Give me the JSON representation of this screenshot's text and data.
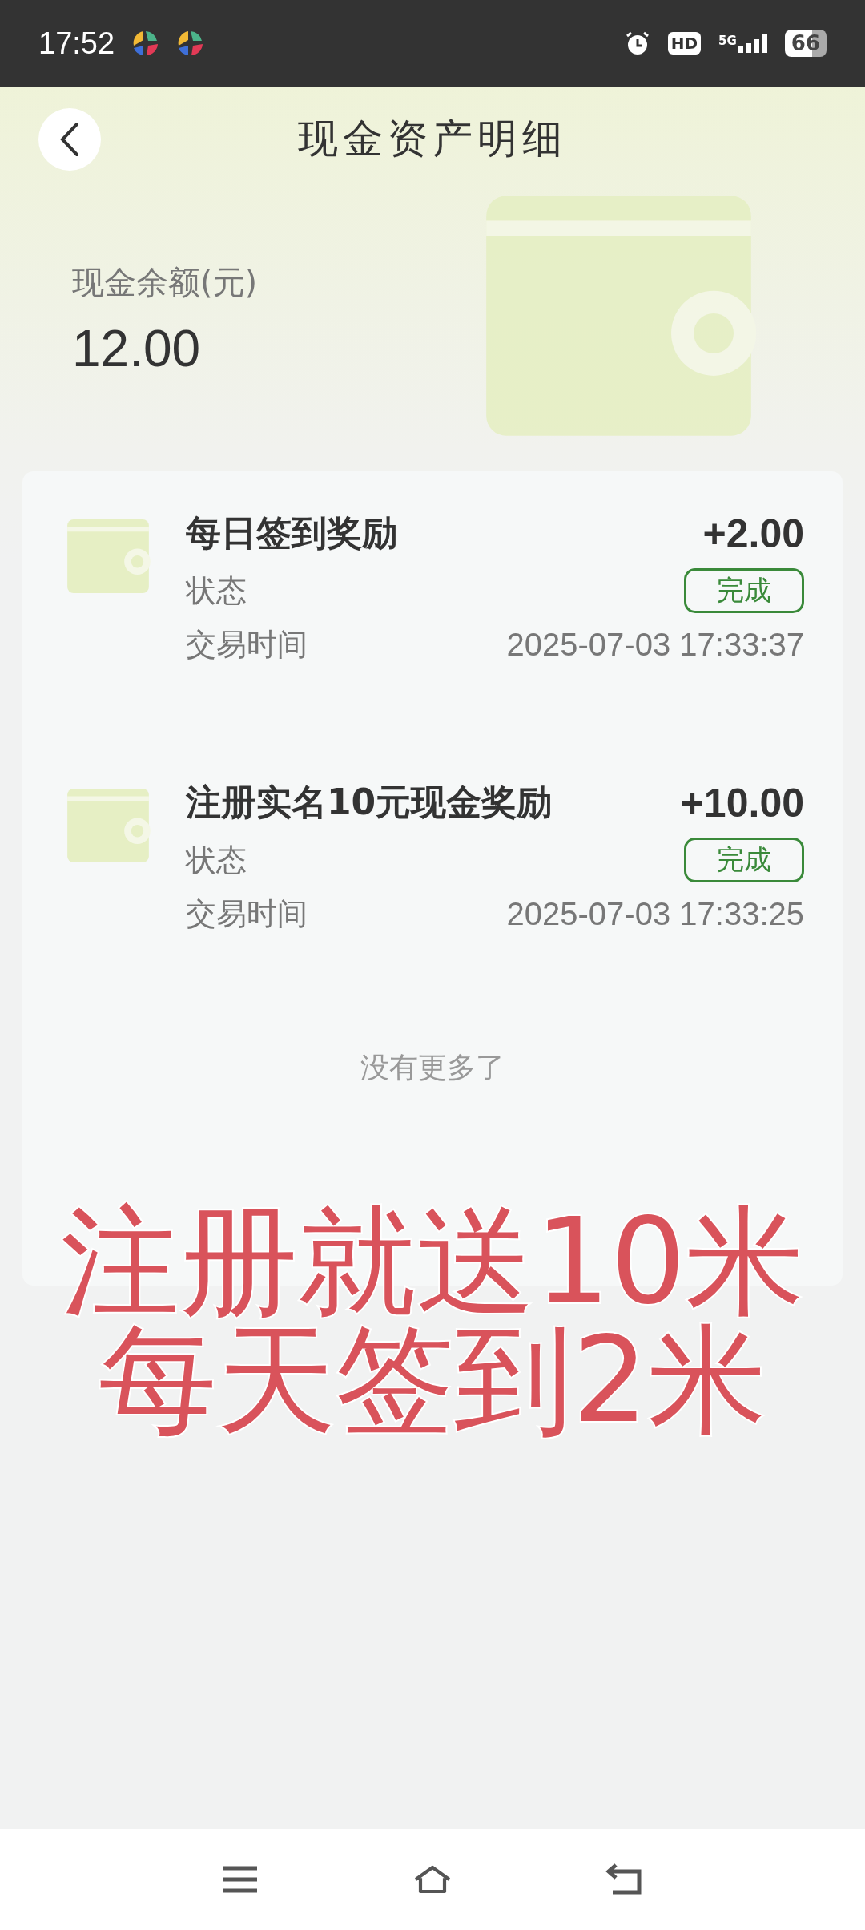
{
  "status_bar": {
    "time": "17:52",
    "hd_label": "HD",
    "network": "5G",
    "battery": "66"
  },
  "header": {
    "title": "现金资产明细"
  },
  "balance": {
    "label": "现金余额(元)",
    "amount": "12.00"
  },
  "transactions": [
    {
      "title": "每日签到奖励",
      "amount": "+2.00",
      "status_label": "状态",
      "status": "完成",
      "time_label": "交易时间",
      "time": "2025-07-03 17:33:37"
    },
    {
      "title": "注册实名10元现金奖励",
      "amount": "+10.00",
      "status_label": "状态",
      "status": "完成",
      "time_label": "交易时间",
      "time": "2025-07-03 17:33:25"
    }
  ],
  "end_note": "没有更多了",
  "overlay_caption": [
    "注册就送10米",
    "每天签到2米"
  ]
}
